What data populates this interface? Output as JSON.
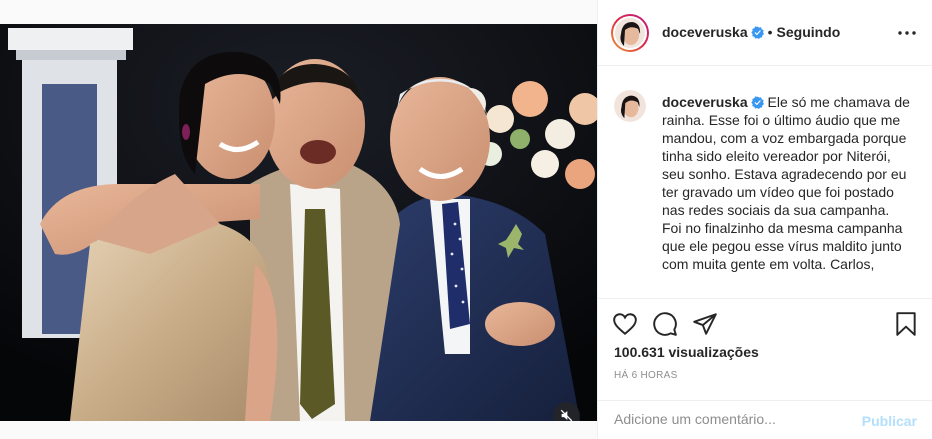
{
  "post": {
    "username": "doceveruska",
    "separator": "•",
    "follow_status": "Seguindo",
    "caption": "Ele só me chamava de rainha. Esse foi o último áudio que me mandou, com a voz embargada porque tinha sido eleito vereador por Niterói, seu sonho. Estava agradecendo por eu ter gravado um vídeo que foi postado nas redes sociais da sua campanha. Foi no finalzinho da mesma campanha que ele pegou esse vírus maldito junto com muita gente em volta. Carlos,",
    "views_count": "100.631",
    "views_label": "visualizações",
    "timestamp": "HÁ 6 HORAS",
    "comment_placeholder": "Adicione um comentário...",
    "publish_label": "Publicar"
  },
  "icons": {
    "verified": "verified-badge-icon",
    "more": "more-options-icon",
    "like": "heart-icon",
    "comment": "comment-bubble-icon",
    "share": "paper-plane-icon",
    "save": "bookmark-icon",
    "mute": "muted-speaker-icon"
  },
  "colors": {
    "verified_blue": "#3897f0",
    "publish_disabled": "#b2dffc",
    "muted_text": "#8e8e8e"
  }
}
